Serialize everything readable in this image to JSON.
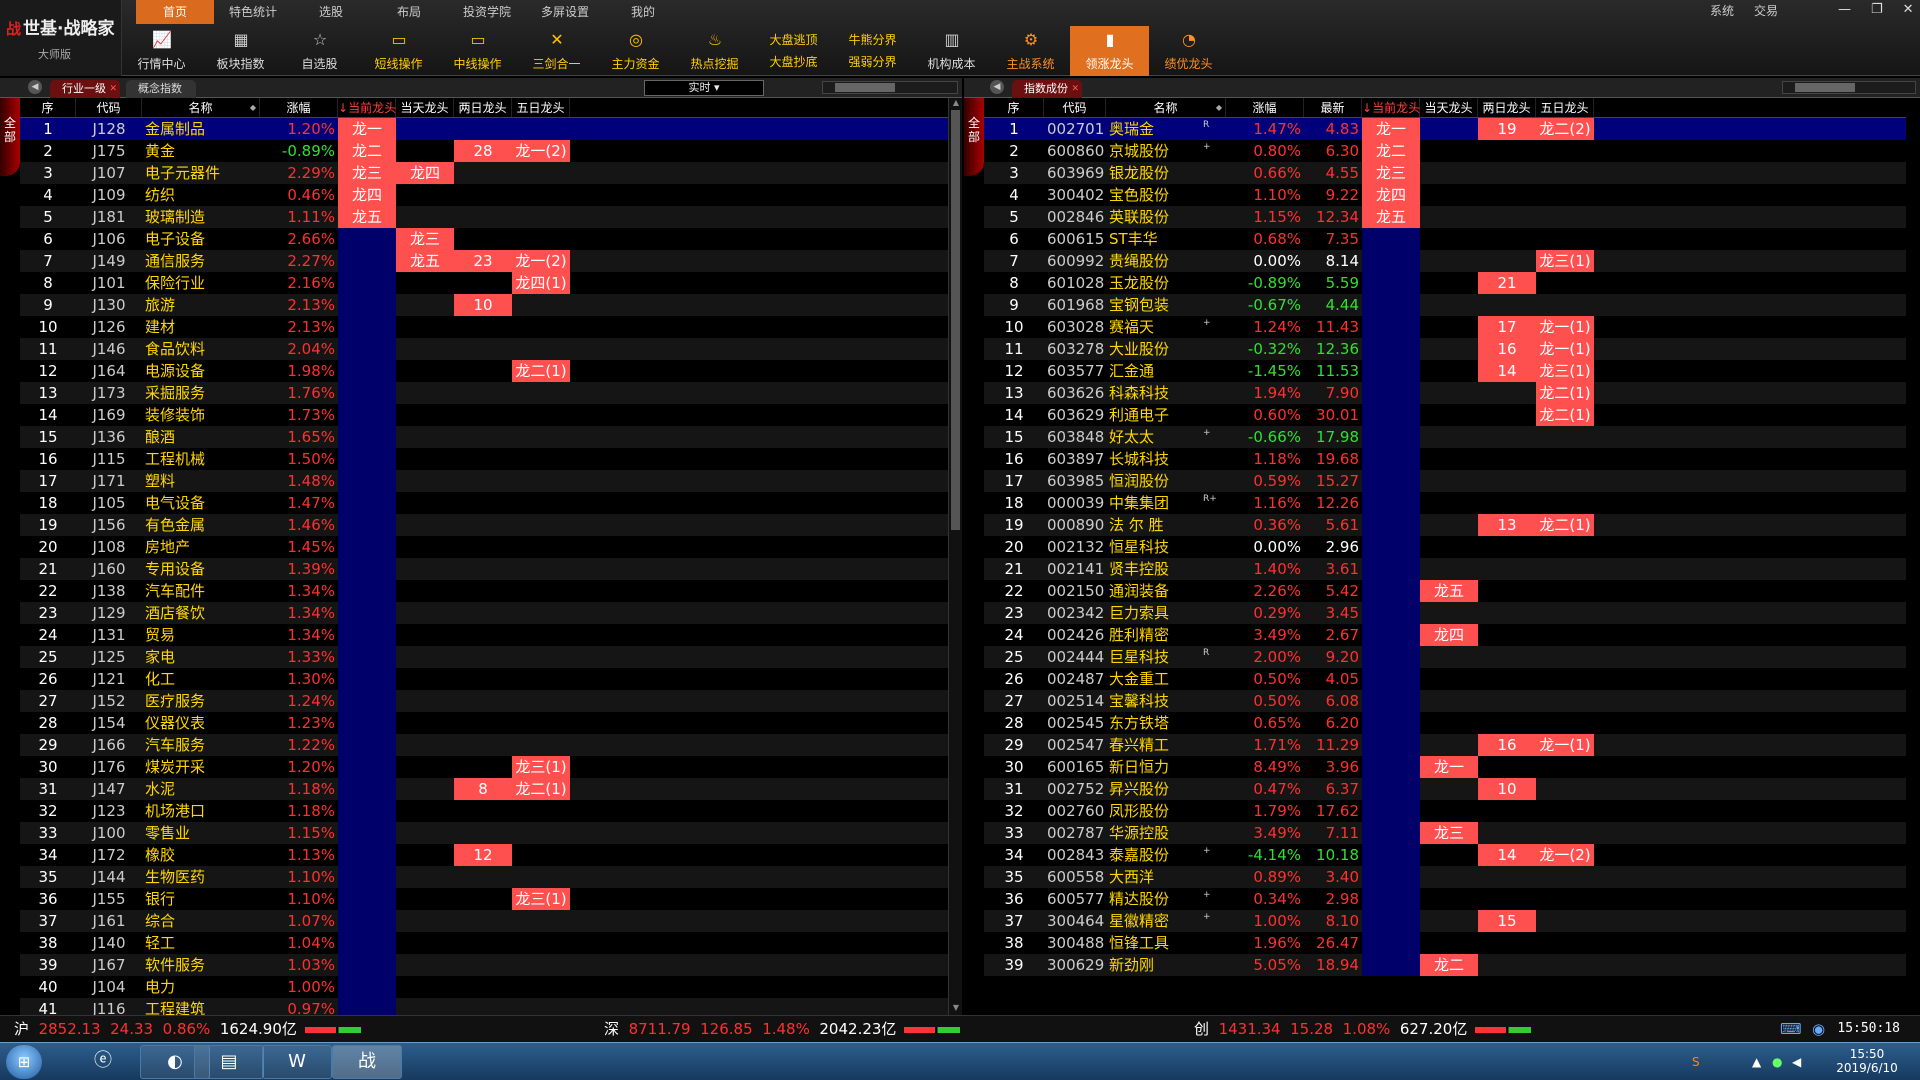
{
  "app": {
    "brand": "世基·战略家",
    "edition": "大师版",
    "logo_mark": "战"
  },
  "menu": [
    "首页",
    "特色统计",
    "选股",
    "布局",
    "投资学院",
    "多屏设置",
    "我的"
  ],
  "sysmenu": [
    "系统",
    "交易"
  ],
  "toolbar": [
    {
      "label": "行情中心",
      "icon": "chart-icon",
      "cls": ""
    },
    {
      "label": "板块指数",
      "icon": "grid-icon",
      "cls": ""
    },
    {
      "label": "自选股",
      "icon": "star-doc-icon",
      "cls": ""
    },
    {
      "label": "短线操作",
      "icon": "monitor-icon",
      "cls": "y"
    },
    {
      "label": "中线操作",
      "icon": "monitor-icon",
      "cls": "y"
    },
    {
      "label": "三剑合一",
      "icon": "swords-icon",
      "cls": "y"
    },
    {
      "label": "主力资金",
      "icon": "coins-icon",
      "cls": "y"
    },
    {
      "label": "热点挖掘",
      "icon": "fire-icon",
      "cls": "y"
    },
    {
      "dual": [
        "大盘逃顶",
        "大盘抄底"
      ]
    },
    {
      "dual": [
        "牛熊分界",
        "强弱分界"
      ]
    },
    {
      "label": "机构成本",
      "icon": "building-icon",
      "cls": ""
    },
    {
      "label": "主战系统",
      "icon": "gear-icon",
      "cls": "o"
    },
    {
      "label": "领涨龙头",
      "icon": "bars-icon",
      "cls": "o active"
    },
    {
      "label": "绩优龙头",
      "icon": "pie-icon",
      "cls": "o"
    }
  ],
  "left_panel": {
    "tabs": [
      "行业一级",
      "概念指数"
    ],
    "period": "实时",
    "side_label": "全部",
    "columns": [
      "序",
      "代码",
      "名称",
      "涨幅",
      "当前龙头",
      "当天龙头",
      "两日龙头",
      "五日龙头"
    ],
    "rows": [
      [
        "1",
        "J128",
        "金属制品",
        "1.20%",
        "龙一",
        "",
        "",
        ""
      ],
      [
        "2",
        "J175",
        "黄金",
        "-0.89%",
        "龙二",
        "",
        "28",
        "龙一(2)"
      ],
      [
        "3",
        "J107",
        "电子元器件",
        "2.29%",
        "龙三",
        "龙四",
        "",
        ""
      ],
      [
        "4",
        "J109",
        "纺织",
        "0.46%",
        "龙四",
        "",
        "",
        ""
      ],
      [
        "5",
        "J181",
        "玻璃制造",
        "1.11%",
        "龙五",
        "",
        "",
        ""
      ],
      [
        "6",
        "J106",
        "电子设备",
        "2.66%",
        "",
        "龙三",
        "",
        ""
      ],
      [
        "7",
        "J149",
        "通信服务",
        "2.27%",
        "",
        "龙五",
        "23",
        "龙一(2)"
      ],
      [
        "8",
        "J101",
        "保险行业",
        "2.16%",
        "",
        "",
        "",
        "龙四(1)"
      ],
      [
        "9",
        "J130",
        "旅游",
        "2.13%",
        "",
        "",
        "10",
        ""
      ],
      [
        "10",
        "J126",
        "建材",
        "2.13%",
        "",
        "",
        "",
        ""
      ],
      [
        "11",
        "J146",
        "食品饮料",
        "2.04%",
        "",
        "",
        "",
        ""
      ],
      [
        "12",
        "J164",
        "电源设备",
        "1.98%",
        "",
        "",
        "",
        "龙二(1)"
      ],
      [
        "13",
        "J173",
        "采掘服务",
        "1.76%",
        "",
        "",
        "",
        ""
      ],
      [
        "14",
        "J169",
        "装修装饰",
        "1.73%",
        "",
        "",
        "",
        ""
      ],
      [
        "15",
        "J136",
        "酿酒",
        "1.65%",
        "",
        "",
        "",
        ""
      ],
      [
        "16",
        "J115",
        "工程机械",
        "1.50%",
        "",
        "",
        "",
        ""
      ],
      [
        "17",
        "J171",
        "塑料",
        "1.48%",
        "",
        "",
        "",
        ""
      ],
      [
        "18",
        "J105",
        "电气设备",
        "1.47%",
        "",
        "",
        "",
        ""
      ],
      [
        "19",
        "J156",
        "有色金属",
        "1.46%",
        "",
        "",
        "",
        ""
      ],
      [
        "20",
        "J108",
        "房地产",
        "1.45%",
        "",
        "",
        "",
        ""
      ],
      [
        "21",
        "J160",
        "专用设备",
        "1.39%",
        "",
        "",
        "",
        ""
      ],
      [
        "22",
        "J138",
        "汽车配件",
        "1.34%",
        "",
        "",
        "",
        ""
      ],
      [
        "23",
        "J129",
        "酒店餐饮",
        "1.34%",
        "",
        "",
        "",
        ""
      ],
      [
        "24",
        "J131",
        "贸易",
        "1.34%",
        "",
        "",
        "",
        ""
      ],
      [
        "25",
        "J125",
        "家电",
        "1.33%",
        "",
        "",
        "",
        ""
      ],
      [
        "26",
        "J121",
        "化工",
        "1.30%",
        "",
        "",
        "",
        ""
      ],
      [
        "27",
        "J152",
        "医疗服务",
        "1.24%",
        "",
        "",
        "",
        ""
      ],
      [
        "28",
        "J154",
        "仪器仪表",
        "1.23%",
        "",
        "",
        "",
        ""
      ],
      [
        "29",
        "J166",
        "汽车服务",
        "1.22%",
        "",
        "",
        "",
        ""
      ],
      [
        "30",
        "J176",
        "煤炭开采",
        "1.20%",
        "",
        "",
        "",
        "龙三(1)"
      ],
      [
        "31",
        "J147",
        "水泥",
        "1.18%",
        "",
        "",
        "8",
        "龙二(1)"
      ],
      [
        "32",
        "J123",
        "机场港口",
        "1.18%",
        "",
        "",
        "",
        ""
      ],
      [
        "33",
        "J100",
        "零售业",
        "1.15%",
        "",
        "",
        "",
        ""
      ],
      [
        "34",
        "J172",
        "橡胶",
        "1.13%",
        "",
        "",
        "12",
        ""
      ],
      [
        "35",
        "J144",
        "生物医药",
        "1.10%",
        "",
        "",
        "",
        ""
      ],
      [
        "36",
        "J155",
        "银行",
        "1.10%",
        "",
        "",
        "",
        "龙三(1)"
      ],
      [
        "37",
        "J161",
        "综合",
        "1.07%",
        "",
        "",
        "",
        ""
      ],
      [
        "38",
        "J140",
        "轻工",
        "1.04%",
        "",
        "",
        "",
        ""
      ],
      [
        "39",
        "J167",
        "软件服务",
        "1.03%",
        "",
        "",
        "",
        ""
      ],
      [
        "40",
        "J104",
        "电力",
        "1.00%",
        "",
        "",
        "",
        ""
      ],
      [
        "41",
        "J116",
        "工程建筑",
        "0.97%",
        "",
        "",
        "",
        ""
      ]
    ]
  },
  "right_panel": {
    "tabs": [
      "指数成份"
    ],
    "side_label": "全部",
    "columns": [
      "序",
      "代码",
      "名称",
      "涨幅",
      "最新",
      "当前龙头",
      "当天龙头",
      "两日龙头",
      "五日龙头"
    ],
    "rows": [
      [
        "1",
        "002701",
        "奥瑞金",
        "R",
        "1.47%",
        "4.83",
        "龙一",
        "",
        "19",
        "龙二(2)"
      ],
      [
        "2",
        "600860",
        "京城股份",
        "+",
        "0.80%",
        "6.30",
        "龙二",
        "",
        "",
        ""
      ],
      [
        "3",
        "603969",
        "银龙股份",
        "",
        "0.66%",
        "4.55",
        "龙三",
        "",
        "",
        ""
      ],
      [
        "4",
        "300402",
        "宝色股份",
        "",
        "1.10%",
        "9.22",
        "龙四",
        "",
        "",
        ""
      ],
      [
        "5",
        "002846",
        "英联股份",
        "",
        "1.15%",
        "12.34",
        "龙五",
        "",
        "",
        ""
      ],
      [
        "6",
        "600615",
        "ST丰华",
        "",
        "0.68%",
        "7.35",
        "",
        "",
        "",
        ""
      ],
      [
        "7",
        "600992",
        "贵绳股份",
        "",
        "0.00%",
        "8.14",
        "",
        "",
        "",
        "龙三(1)"
      ],
      [
        "8",
        "601028",
        "玉龙股份",
        "",
        "-0.89%",
        "5.59",
        "",
        "",
        "21",
        ""
      ],
      [
        "9",
        "601968",
        "宝钢包装",
        "",
        "-0.67%",
        "4.44",
        "",
        "",
        "",
        ""
      ],
      [
        "10",
        "603028",
        "赛福天",
        "+",
        "1.24%",
        "11.43",
        "",
        "",
        "17",
        "龙一(1)"
      ],
      [
        "11",
        "603278",
        "大业股份",
        "",
        "-0.32%",
        "12.36",
        "",
        "",
        "16",
        "龙一(1)"
      ],
      [
        "12",
        "603577",
        "汇金通",
        "",
        "-1.45%",
        "11.53",
        "",
        "",
        "14",
        "龙三(1)"
      ],
      [
        "13",
        "603626",
        "科森科技",
        "",
        "1.94%",
        "7.90",
        "",
        "",
        "",
        "龙二(1)"
      ],
      [
        "14",
        "603629",
        "利通电子",
        "",
        "0.60%",
        "30.01",
        "",
        "",
        "",
        "龙二(1)"
      ],
      [
        "15",
        "603848",
        "好太太",
        "+",
        "-0.66%",
        "17.98",
        "",
        "",
        "",
        ""
      ],
      [
        "16",
        "603897",
        "长城科技",
        "",
        "1.18%",
        "19.68",
        "",
        "",
        "",
        ""
      ],
      [
        "17",
        "603985",
        "恒润股份",
        "",
        "0.59%",
        "15.27",
        "",
        "",
        "",
        ""
      ],
      [
        "18",
        "000039",
        "中集集团",
        "R+",
        "1.16%",
        "12.26",
        "",
        "",
        "",
        ""
      ],
      [
        "19",
        "000890",
        "法 尔 胜",
        "",
        "0.36%",
        "5.61",
        "",
        "",
        "13",
        "龙二(1)"
      ],
      [
        "20",
        "002132",
        "恒星科技",
        "",
        "0.00%",
        "2.96",
        "",
        "",
        "",
        ""
      ],
      [
        "21",
        "002141",
        "贤丰控股",
        "",
        "1.40%",
        "3.61",
        "",
        "",
        "",
        ""
      ],
      [
        "22",
        "002150",
        "通润装备",
        "",
        "2.26%",
        "5.42",
        "",
        "龙五",
        "",
        ""
      ],
      [
        "23",
        "002342",
        "巨力索具",
        "",
        "0.29%",
        "3.45",
        "",
        "",
        "",
        ""
      ],
      [
        "24",
        "002426",
        "胜利精密",
        "",
        "3.49%",
        "2.67",
        "",
        "龙四",
        "",
        ""
      ],
      [
        "25",
        "002444",
        "巨星科技",
        "R",
        "2.00%",
        "9.20",
        "",
        "",
        "",
        ""
      ],
      [
        "26",
        "002487",
        "大金重工",
        "",
        "0.50%",
        "4.05",
        "",
        "",
        "",
        ""
      ],
      [
        "27",
        "002514",
        "宝馨科技",
        "",
        "0.50%",
        "6.08",
        "",
        "",
        "",
        ""
      ],
      [
        "28",
        "002545",
        "东方铁塔",
        "",
        "0.65%",
        "6.20",
        "",
        "",
        "",
        ""
      ],
      [
        "29",
        "002547",
        "春兴精工",
        "",
        "1.71%",
        "11.29",
        "",
        "",
        "16",
        "龙一(1)"
      ],
      [
        "30",
        "600165",
        "新日恒力",
        "",
        "8.49%",
        "3.96",
        "",
        "龙一",
        "",
        ""
      ],
      [
        "31",
        "002752",
        "昇兴股份",
        "",
        "0.47%",
        "6.37",
        "",
        "",
        "10",
        ""
      ],
      [
        "32",
        "002760",
        "凤形股份",
        "",
        "1.79%",
        "17.62",
        "",
        "",
        "",
        ""
      ],
      [
        "33",
        "002787",
        "华源控股",
        "",
        "3.49%",
        "7.11",
        "",
        "龙三",
        "",
        ""
      ],
      [
        "34",
        "002843",
        "泰嘉股份",
        "+",
        "-4.14%",
        "10.18",
        "",
        "",
        "14",
        "龙一(2)"
      ],
      [
        "35",
        "600558",
        "大西洋",
        "",
        "0.89%",
        "3.40",
        "",
        "",
        "",
        ""
      ],
      [
        "36",
        "600577",
        "精达股份",
        "+",
        "0.34%",
        "2.98",
        "",
        "",
        "",
        ""
      ],
      [
        "37",
        "300464",
        "星徽精密",
        "+",
        "1.00%",
        "8.10",
        "",
        "",
        "15",
        ""
      ],
      [
        "38",
        "300488",
        "恒锋工具",
        "",
        "1.96%",
        "26.47",
        "",
        "",
        "",
        ""
      ],
      [
        "39",
        "300629",
        "新劲刚",
        "",
        "5.05%",
        "18.94",
        "",
        "龙二",
        "",
        ""
      ]
    ]
  },
  "status": {
    "sh": {
      "label": "沪",
      "index": "2852.13",
      "chg": "24.33",
      "pct": "0.86%",
      "amount": "1624.90亿"
    },
    "sz": {
      "label": "深",
      "index": "8711.79",
      "chg": "126.85",
      "pct": "1.48%",
      "amount": "2042.23亿"
    },
    "cy": {
      "label": "创",
      "index": "1431.34",
      "chg": "15.28",
      "pct": "1.08%",
      "amount": "627.20亿"
    },
    "clock": "15:50:18"
  },
  "taskbar": {
    "time": "15:50",
    "date": "2019/6/10"
  }
}
